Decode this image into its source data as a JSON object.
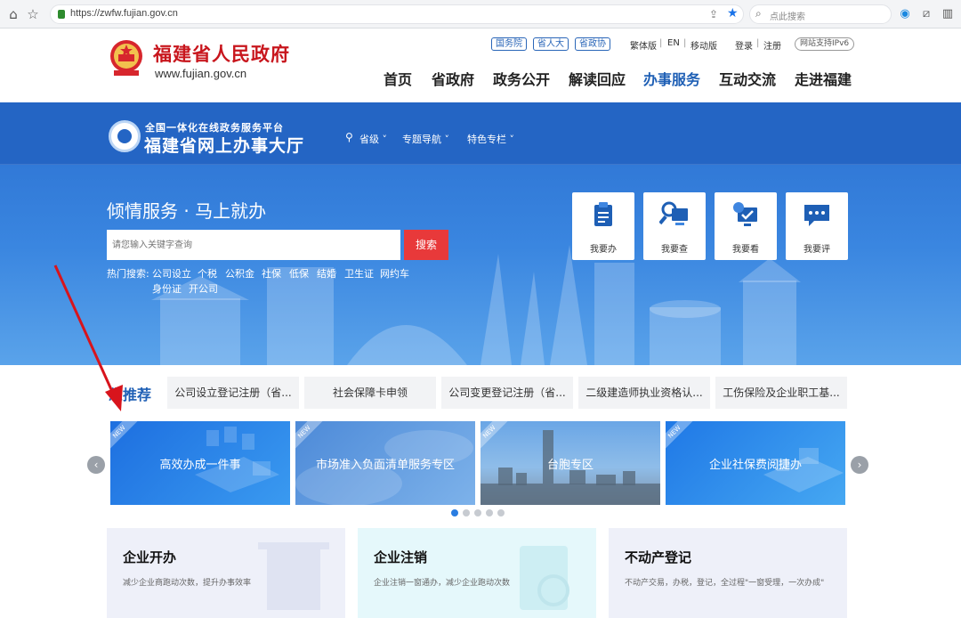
{
  "browser": {
    "url": "https://zwfw.fujian.gov.cn",
    "search_placeholder": "点此搜索"
  },
  "gov_header": {
    "site_name": "福建省人民政府",
    "site_url": "www.fujian.gov.cn",
    "tags": [
      "国务院",
      "省人大",
      "省政协"
    ],
    "top_links": [
      "繁体版",
      "EN",
      "移动版"
    ],
    "login": "登录",
    "register": "注册",
    "ipv6": "网站支持IPv6",
    "nav": [
      "首页",
      "省政府",
      "政务公开",
      "解读回应",
      "办事服务",
      "互动交流",
      "走进福建"
    ],
    "active_nav": "办事服务"
  },
  "hall": {
    "subtitle": "全国一体化在线政务服务平台",
    "title": "福建省网上办事大厅",
    "menu": [
      "省级",
      "专题导航",
      "特色专栏"
    ],
    "slogan": "倾情服务 · 马上就办",
    "search_placeholder": "请您输入关键字查询",
    "search_button": "搜索",
    "hot_label": "热门搜索:",
    "hot_items_row1": [
      "公司设立",
      "个税",
      "公积金",
      "社保",
      "低保",
      "结婚",
      "卫生证",
      "网约车"
    ],
    "hot_items_row2": [
      "身份证",
      "开公司"
    ],
    "quick_cards": [
      "我要办",
      "我要查",
      "我要看",
      "我要评"
    ]
  },
  "recommend": {
    "title_suffix": "您推荐",
    "tabs": [
      "公司设立登记注册（省...",
      "社会保障卡申领",
      "公司变更登记注册（省...",
      "二级建造师执业资格认...",
      "工伤保险及企业职工基..."
    ],
    "banners": [
      "高效办成一件事",
      "市场准入负面清单服务专区",
      "台胞专区",
      "企业社保费阅捷办"
    ],
    "new_tag": "NEW",
    "prev_arrow": "‹",
    "next_arrow": "›",
    "page_count": 5,
    "active_page": 1
  },
  "services": [
    {
      "title": "企业开办",
      "desc": "减少企业商跑动次数，提升办事效率"
    },
    {
      "title": "企业注销",
      "desc": "企业注销一窗通办，减少企业跑动次数"
    },
    {
      "title": "不动产登记",
      "desc": "不动产交易，办税，登记，全过程\"一窗受理，一次办成\""
    }
  ],
  "colors": {
    "accent_blue": "#1e5fb5",
    "gov_red": "#c8161d",
    "search_red": "#e8393a",
    "annotation_arrow": "#d8141c"
  }
}
